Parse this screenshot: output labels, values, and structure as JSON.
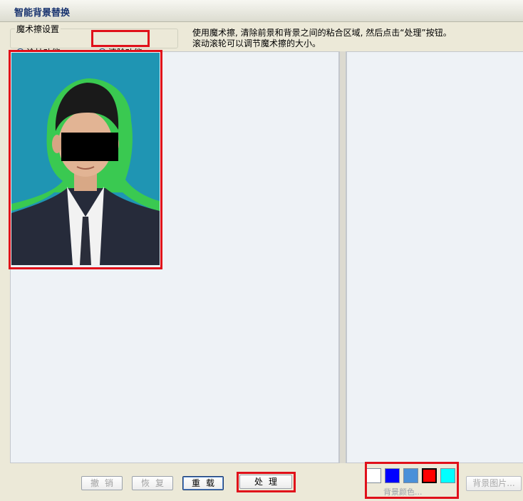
{
  "window": {
    "title": "智能背景替换"
  },
  "settings": {
    "legend": "魔术擦设置",
    "options": [
      {
        "label": "涂抹功能",
        "selected": false
      },
      {
        "label": "清除功能",
        "selected": true
      }
    ]
  },
  "instructions": {
    "line1": "使用魔术擦, 清除前景和背景之间的粘合区域, 然后点击“处理”按钮。",
    "line2": "滚动滚轮可以调节魔术擦的大小。"
  },
  "buttons": {
    "undo": "撤销",
    "redo": "恢复",
    "reload": "重载",
    "process": "处理"
  },
  "background": {
    "colors_label": "背景颜色...",
    "image_label": "背景图片...",
    "swatches": [
      {
        "name": "white",
        "color": "#ffffff",
        "selected": false
      },
      {
        "name": "blue",
        "color": "#0000ff",
        "selected": false
      },
      {
        "name": "light-blue",
        "color": "#4a90d9",
        "selected": false
      },
      {
        "name": "red",
        "color": "#ff0000",
        "selected": true
      },
      {
        "name": "cyan",
        "color": "#00ffff",
        "selected": false
      }
    ]
  },
  "photo": {
    "background_color": "#1f95b3",
    "edge_color": "#2ec12e"
  },
  "accent": {
    "highlight_color": "#e0101a"
  }
}
